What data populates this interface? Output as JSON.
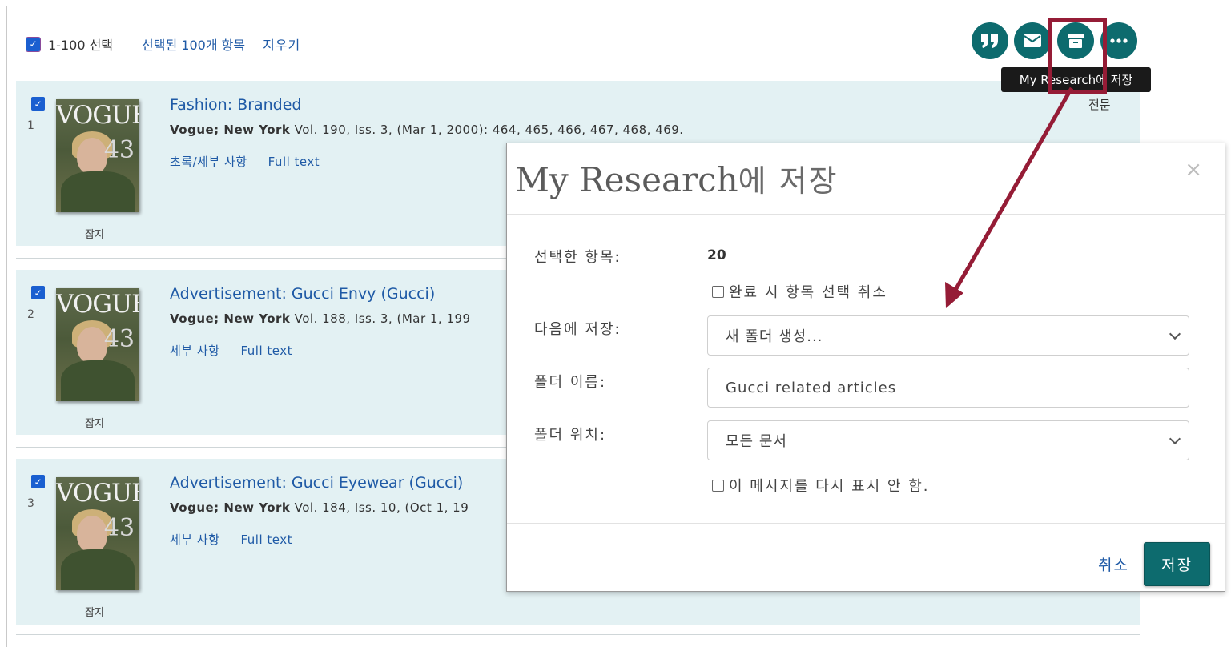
{
  "toolbar": {
    "select_label": "1-100 선택",
    "selected_items": "선택된 100개 항목",
    "clear_label": "지우기",
    "tooltip": "My Research에 저장",
    "icons": [
      "cite-icon",
      "email-icon",
      "save-archive-icon",
      "more-icon"
    ]
  },
  "results": [
    {
      "number": "1",
      "cover_text": "VOGUE",
      "cover_issue": "43",
      "type": "잡지",
      "title": "Fashion: Branded",
      "publication": "Vogue; New York",
      "details": "Vol. 190, Iss. 3,  (Mar 1, 2000): 464, 465, 466, 467, 468, 469.",
      "links": [
        "초록/세부 사항",
        "Full text"
      ],
      "fulltext_label": "전문"
    },
    {
      "number": "2",
      "cover_text": "VOGUE",
      "cover_issue": "43",
      "type": "잡지",
      "title": "Advertisement: Gucci Envy (Gucci)",
      "publication": "Vogue; New York",
      "details": "Vol. 188, Iss. 3,  (Mar 1, 199",
      "links": [
        "세부 사항",
        "Full text"
      ]
    },
    {
      "number": "3",
      "cover_text": "VOGUE",
      "cover_issue": "43",
      "type": "잡지",
      "title": "Advertisement: Gucci Eyewear (Gucci)",
      "publication": "Vogue; New York",
      "details": "Vol. 184, Iss. 10,  (Oct 1, 19",
      "links": [
        "세부 사항",
        "Full text"
      ]
    }
  ],
  "dialog": {
    "title_en": "My Research",
    "title_ko": "에 저장",
    "close": "×",
    "selected_label": "선택한 항목:",
    "selected_value": "20",
    "deselect_label": "완료 시 항목 선택 취소",
    "save_to_label": "다음에 저장:",
    "save_to_value": "새 폴더 생성...",
    "folder_name_label": "폴더 이름:",
    "folder_name_value": "Gucci related articles",
    "folder_location_label": "폴더 위치:",
    "folder_location_value": "모든 문서",
    "dont_show_label": "이 메시지를 다시 표시 안 함.",
    "cancel_label": "취소",
    "save_label": "저장"
  },
  "colors": {
    "accent_teal": "#0d6b6e",
    "highlight_red": "#951c36",
    "link_blue": "#1f5aa6",
    "row_bg": "#e3f1f3"
  }
}
